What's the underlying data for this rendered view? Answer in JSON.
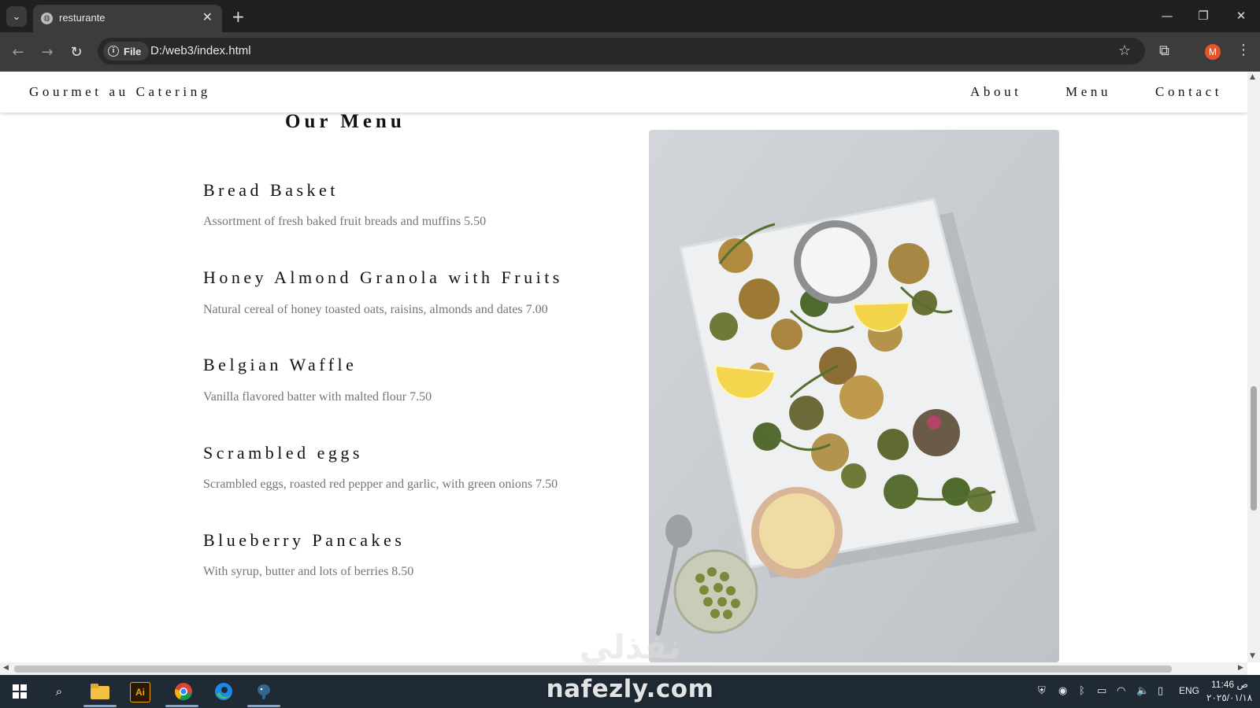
{
  "browser": {
    "tab_title": "resturante",
    "close_glyph": "✕",
    "new_tab_glyph": "+",
    "url_scheme_label": "File",
    "url": "D:/web3/index.html",
    "profile_initial": "M",
    "window_controls": {
      "minimize": "—",
      "restore": "❐",
      "close": "✕"
    }
  },
  "site": {
    "brand": "Gourmet au Catering",
    "nav": [
      "About",
      "Menu",
      "Contact"
    ]
  },
  "menu": {
    "title": "Our Menu",
    "items": [
      {
        "name": "Bread Basket",
        "description": "Assortment of fresh baked fruit breads and muffins 5.50"
      },
      {
        "name": "Honey Almond Granola with Fruits",
        "description": "Natural cereal of honey toasted oats, raisins, almonds and dates 7.00"
      },
      {
        "name": "Belgian Waffle",
        "description": "Vanilla flavored batter with malted flour 7.50"
      },
      {
        "name": "Scrambled eggs",
        "description": "Scrambled eggs, roasted red pepper and garlic, with green onions 7.50"
      },
      {
        "name": "Blueberry Pancakes",
        "description": "With syrup, butter and lots of berries 8.50"
      }
    ]
  },
  "taskbar": {
    "language": "ENG",
    "time": "11:46 ص",
    "date": "٢٠٢٥/٠١/١٨"
  },
  "watermark": {
    "url": "nafezly.com",
    "arabic": "نفذلي"
  },
  "colors": {
    "accent_profile": "#e8542a",
    "taskbar": "#1f2a35",
    "chrome_dark": "#1f2020"
  }
}
